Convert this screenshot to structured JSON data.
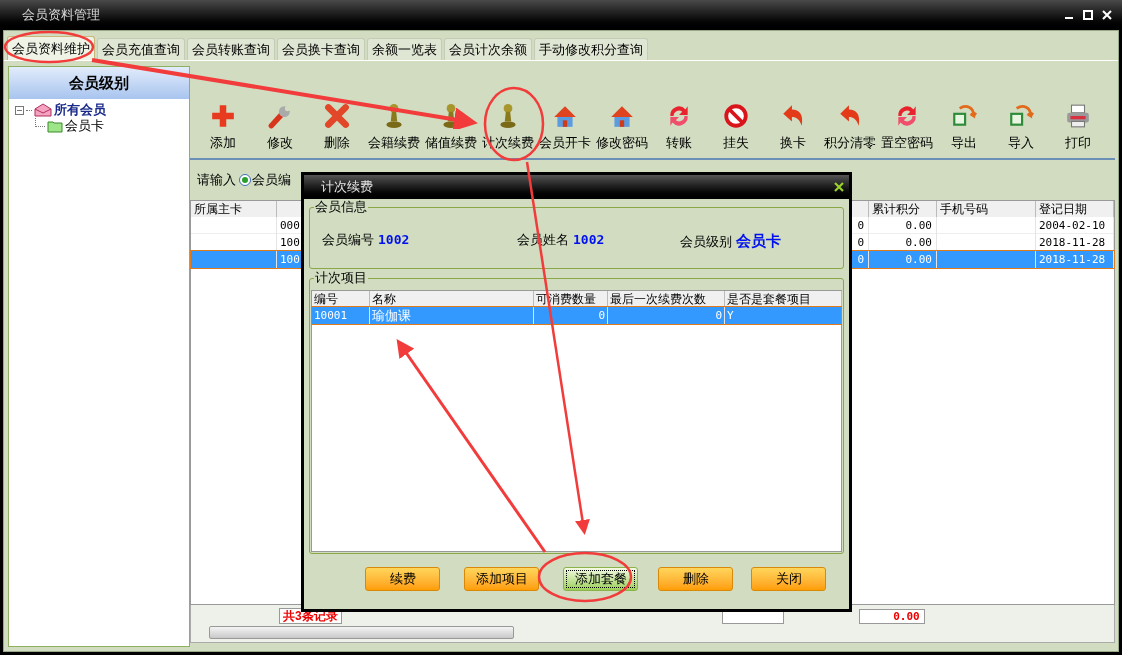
{
  "window": {
    "title": "会员资料管理"
  },
  "tabs": [
    {
      "label": "会员资料维护",
      "selected": true
    },
    {
      "label": "会员充值查询",
      "selected": false
    },
    {
      "label": "会员转账查询",
      "selected": false
    },
    {
      "label": "会员换卡查询",
      "selected": false
    },
    {
      "label": "余额一览表",
      "selected": false
    },
    {
      "label": "会员计次余额",
      "selected": false
    },
    {
      "label": "手动修改积分查询",
      "selected": false
    }
  ],
  "sidebar": {
    "title": "会员级别",
    "tree": [
      {
        "label": "所有会员",
        "expanded": true,
        "children": [
          {
            "label": "会员卡"
          }
        ]
      }
    ]
  },
  "toolbar": [
    {
      "label": "添加"
    },
    {
      "label": "修改"
    },
    {
      "label": "删除"
    },
    {
      "label": "会籍续费"
    },
    {
      "label": "储值续费"
    },
    {
      "label": "计次续费"
    },
    {
      "label": "会员开卡"
    },
    {
      "label": "修改密码"
    },
    {
      "label": "转账"
    },
    {
      "label": "挂失"
    },
    {
      "label": "换卡"
    },
    {
      "label": "积分清零"
    },
    {
      "label": "置空密码"
    },
    {
      "label": "导出"
    },
    {
      "label": "导入"
    },
    {
      "label": "打印"
    }
  ],
  "search": {
    "label": "请输入",
    "options": [
      {
        "label": "会员编",
        "selected": true
      }
    ]
  },
  "member_table": {
    "columns": [
      "所属主卡",
      "累计积分",
      "手机号码",
      "登记日期"
    ],
    "rows": [
      {
        "code": "000",
        "count": "0",
        "points": "0.00",
        "date": "2004-02-10",
        "selected": false
      },
      {
        "code": "100",
        "count": "0",
        "points": "0.00",
        "date": "2018-11-28",
        "selected": false
      },
      {
        "code": "100",
        "count": "0",
        "points": "0.00",
        "date": "2018-11-28",
        "selected": true
      }
    ]
  },
  "footer": {
    "record_count": "共3条记录",
    "total": "0.00"
  },
  "dialog": {
    "title": "计次续费",
    "member_info": {
      "title": "会员信息",
      "fields": [
        {
          "label": "会员编号",
          "value": "1002"
        },
        {
          "label": "会员姓名",
          "value": "1002"
        },
        {
          "label": "会员级别",
          "value": "会员卡"
        }
      ]
    },
    "items": {
      "title": "计次项目",
      "columns": [
        "编号",
        "名称",
        "可消费数量",
        "最后一次续费次数",
        "是否是套餐项目"
      ],
      "rows": [
        {
          "cells": [
            "10001",
            "瑜伽课",
            "0",
            "0",
            "Y"
          ],
          "selected": true
        }
      ]
    },
    "buttons": [
      {
        "label": "续费",
        "focused": false
      },
      {
        "label": "添加项目",
        "focused": false
      },
      {
        "label": "添加套餐",
        "focused": true
      },
      {
        "label": "删除",
        "focused": false
      },
      {
        "label": "关闭",
        "focused": false
      }
    ]
  }
}
